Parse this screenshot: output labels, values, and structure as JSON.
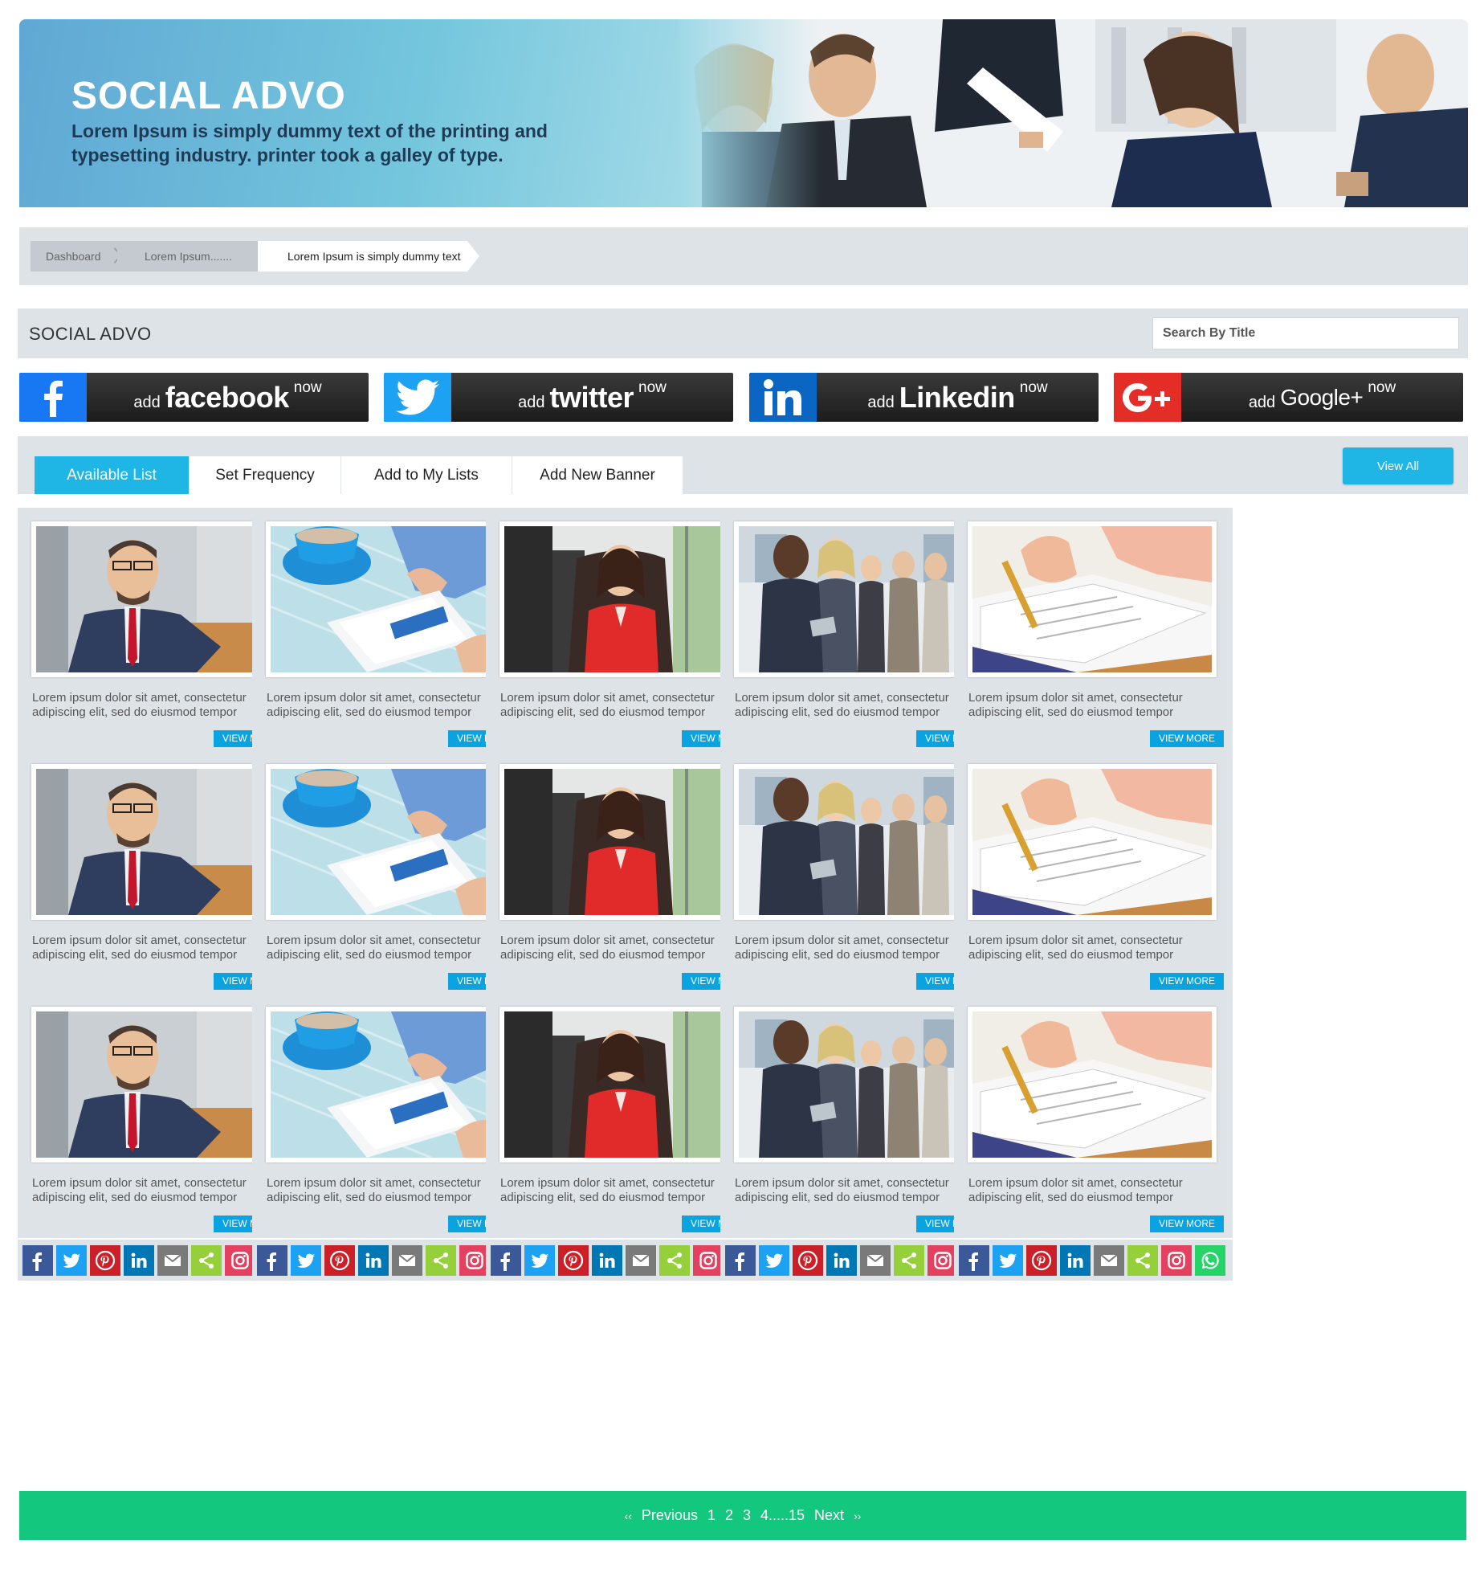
{
  "hero": {
    "title": "SOCIAL ADVO",
    "subtitle": "Lorem Ipsum is simply dummy text of the printing and typesetting industry. printer took a galley of type."
  },
  "breadcrumb": [
    "Dashboard",
    "Lorem Ipsum.......",
    "Lorem Ipsum is simply dummy text"
  ],
  "section": {
    "title": "SOCIAL ADVO",
    "search_placeholder": "Search By Title"
  },
  "cta": [
    {
      "add": "add",
      "brand": "facebook",
      "now": "now",
      "icon": "facebook-icon",
      "color": "#1877f2"
    },
    {
      "add": "add",
      "brand": "twitter",
      "now": "now",
      "icon": "twitter-icon",
      "color": "#1da1f2"
    },
    {
      "add": "add",
      "brand": "Linkedin",
      "now": "now",
      "icon": "linkedin-icon",
      "color": "#0a66c2"
    },
    {
      "add": "add",
      "brand": "Google+",
      "now": "now",
      "icon": "google-plus-icon",
      "color": "#e52d27"
    }
  ],
  "tabs": [
    "Available List",
    "Set Frequency",
    "Add to My Lists",
    "Add New Banner"
  ],
  "active_tab": 0,
  "view_all": "View All",
  "card_text": "Lorem ipsum dolor sit amet, consectetur adipiscing elit, sed do eiusmod tempor",
  "view_more": "VIEW MORE",
  "card_images": [
    "businessman-smiling",
    "coffee-tablet",
    "businesswoman-red-jacket",
    "business-team",
    "hand-signing-document"
  ],
  "share_icons": [
    {
      "name": "facebook",
      "color": "#3b5998"
    },
    {
      "name": "twitter",
      "color": "#1da1f2"
    },
    {
      "name": "pinterest",
      "color": "#cb2027"
    },
    {
      "name": "linkedin",
      "color": "#0077b5"
    },
    {
      "name": "email",
      "color": "#7a7a7a"
    },
    {
      "name": "share",
      "color": "#95d03a"
    },
    {
      "name": "instagram",
      "color": "#e4405f"
    },
    {
      "name": "whatsapp",
      "color": "#25d366"
    }
  ],
  "pagination": {
    "prev_arrow": "‹‹",
    "previous": "Previous",
    "pages": [
      "1",
      "2",
      "3",
      "4.....15"
    ],
    "next": "Next",
    "next_arrow": "››"
  }
}
